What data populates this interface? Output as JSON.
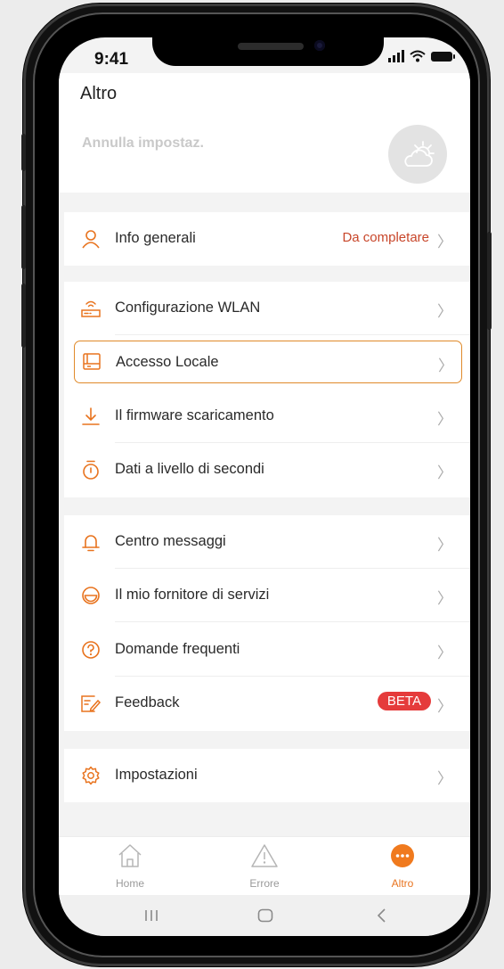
{
  "status_bar": {
    "time": "9:41"
  },
  "header": {
    "title": "Altro",
    "cancel_label": "Annulla impostaz.",
    "weather_icon": "cloud-sun-icon"
  },
  "sections": [
    {
      "items": [
        {
          "id": "info",
          "icon": "user-icon",
          "label": "Info generali",
          "status": "Da completare"
        }
      ]
    },
    {
      "items": [
        {
          "id": "wlan",
          "icon": "router-icon",
          "label": "Configurazione WLAN"
        },
        {
          "id": "local",
          "icon": "local-access-icon",
          "label": "Accesso Locale",
          "highlighted": true
        },
        {
          "id": "firmware",
          "icon": "download-icon",
          "label": "Il firmware scaricamento"
        },
        {
          "id": "seconds",
          "icon": "stopwatch-icon",
          "label": "Dati a livello di secondi"
        }
      ]
    },
    {
      "items": [
        {
          "id": "messages",
          "icon": "bell-icon",
          "label": "Centro messaggi"
        },
        {
          "id": "provider",
          "icon": "provider-icon",
          "label": "Il mio fornitore di servizi"
        },
        {
          "id": "faq",
          "icon": "question-icon",
          "label": "Domande frequenti"
        },
        {
          "id": "feedback",
          "icon": "feedback-icon",
          "label": "Feedback",
          "badge": "BETA"
        }
      ]
    },
    {
      "items": [
        {
          "id": "settings",
          "icon": "gear-icon",
          "label": "Impostazioni"
        }
      ]
    }
  ],
  "tabs": [
    {
      "label": "Home",
      "icon": "home-icon"
    },
    {
      "label": "Errore",
      "icon": "warning-icon"
    },
    {
      "label": "Altro",
      "icon": "more-icon",
      "active": true
    }
  ],
  "colors": {
    "accent": "#e8731e",
    "status_text": "#c8462a",
    "beta_badge": "#e53b3b",
    "highlight_border": "#e08a2a"
  }
}
